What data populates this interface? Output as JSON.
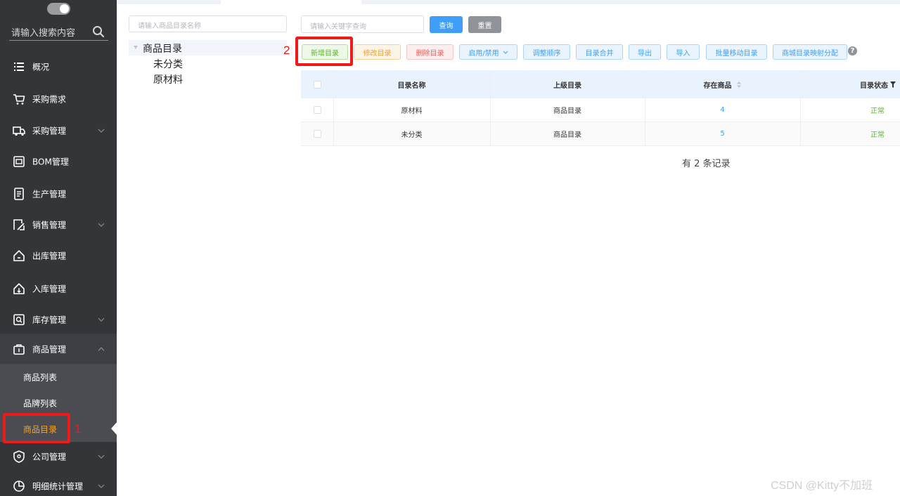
{
  "sidebar": {
    "search_placeholder": "请输入搜索内容",
    "items": [
      {
        "label": "概况",
        "icon": "list-icon"
      },
      {
        "label": "采购需求",
        "icon": "cart-icon"
      },
      {
        "label": "采购管理",
        "icon": "truck-icon"
      },
      {
        "label": "BOM管理",
        "icon": "box-icon"
      },
      {
        "label": "生产管理",
        "icon": "factory-icon"
      },
      {
        "label": "销售管理",
        "icon": "sales-icon"
      },
      {
        "label": "出库管理",
        "icon": "outbound-icon"
      },
      {
        "label": "入库管理",
        "icon": "inbound-icon"
      },
      {
        "label": "库存管理",
        "icon": "inventory-icon"
      },
      {
        "label": "商品管理",
        "icon": "goods-icon"
      },
      {
        "label": "公司管理",
        "icon": "company-icon"
      },
      {
        "label": "明细统计管理",
        "icon": "chart-pie-icon"
      }
    ],
    "submenu": [
      {
        "label": "商品列表"
      },
      {
        "label": "品牌列表"
      },
      {
        "label": "商品目录",
        "active": true
      }
    ]
  },
  "tree": {
    "search_placeholder": "请输入商品目录名称",
    "root": "商品目录",
    "children": [
      "未分类",
      "原材料"
    ]
  },
  "search": {
    "placeholder": "请输入关键字查询",
    "query_label": "查询",
    "reset_label": "重置"
  },
  "toolbar": {
    "add": "新增目录",
    "edit": "修改目录",
    "delete": "删除目录",
    "toggle": "启用/禁用",
    "reorder": "调整顺序",
    "merge": "目录合并",
    "export": "导出",
    "import": "导入",
    "batch_move": "批量移动目录",
    "mapping": "商城目录映射分配",
    "help": "?"
  },
  "table": {
    "headers": [
      "目录名称",
      "上级目录",
      "存在商品",
      "目录状态"
    ],
    "rows": [
      {
        "name": "原材料",
        "parent": "商品目录",
        "count": "4",
        "status": "正常"
      },
      {
        "name": "未分类",
        "parent": "商品目录",
        "count": "5",
        "status": "正常"
      }
    ]
  },
  "records": "有 2 条记录",
  "annotations": {
    "one": "1",
    "two": "2"
  },
  "watermark": "CSDN @Kitty不加班",
  "colors": {
    "sidebar_bg": "#333539",
    "active_text": "#f6a623",
    "primary": "#3f9ef7",
    "success": "#5fb533",
    "annotation_red": "#ef1a1a"
  }
}
